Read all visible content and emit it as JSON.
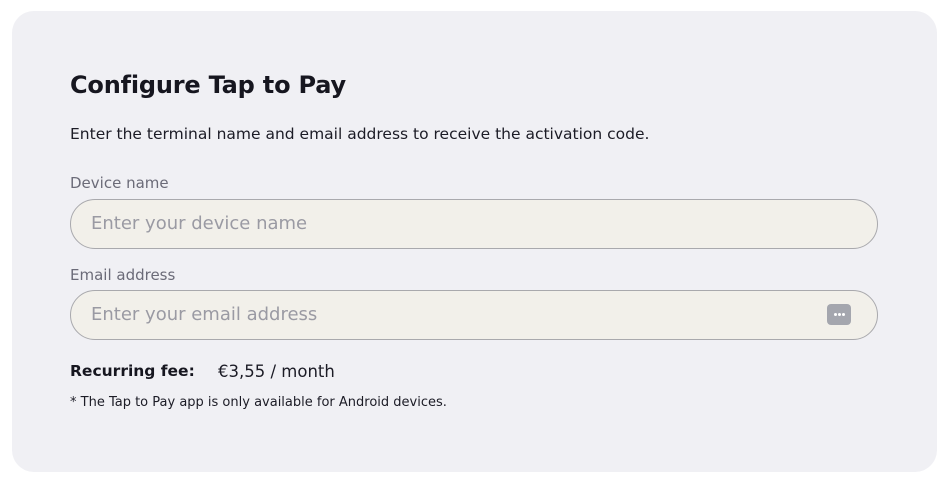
{
  "form": {
    "title": "Configure Tap to Pay",
    "description": "Enter the terminal name and email address to receive the activation code.",
    "device_name": {
      "label": "Device name",
      "placeholder": "Enter your device name",
      "value": ""
    },
    "email": {
      "label": "Email address",
      "placeholder": "Enter your email address",
      "value": "",
      "icon": "password-manager-icon"
    },
    "fee": {
      "label": "Recurring fee:",
      "value": "€3,55 / month"
    },
    "footnote": "* The Tap to Pay app is only available for Android devices."
  },
  "colors": {
    "card_background": "#f0f0f4",
    "input_background": "#f2f0ea",
    "input_border": "#a9a9ad",
    "text_primary": "#16161f",
    "text_muted": "#6b6b78"
  }
}
